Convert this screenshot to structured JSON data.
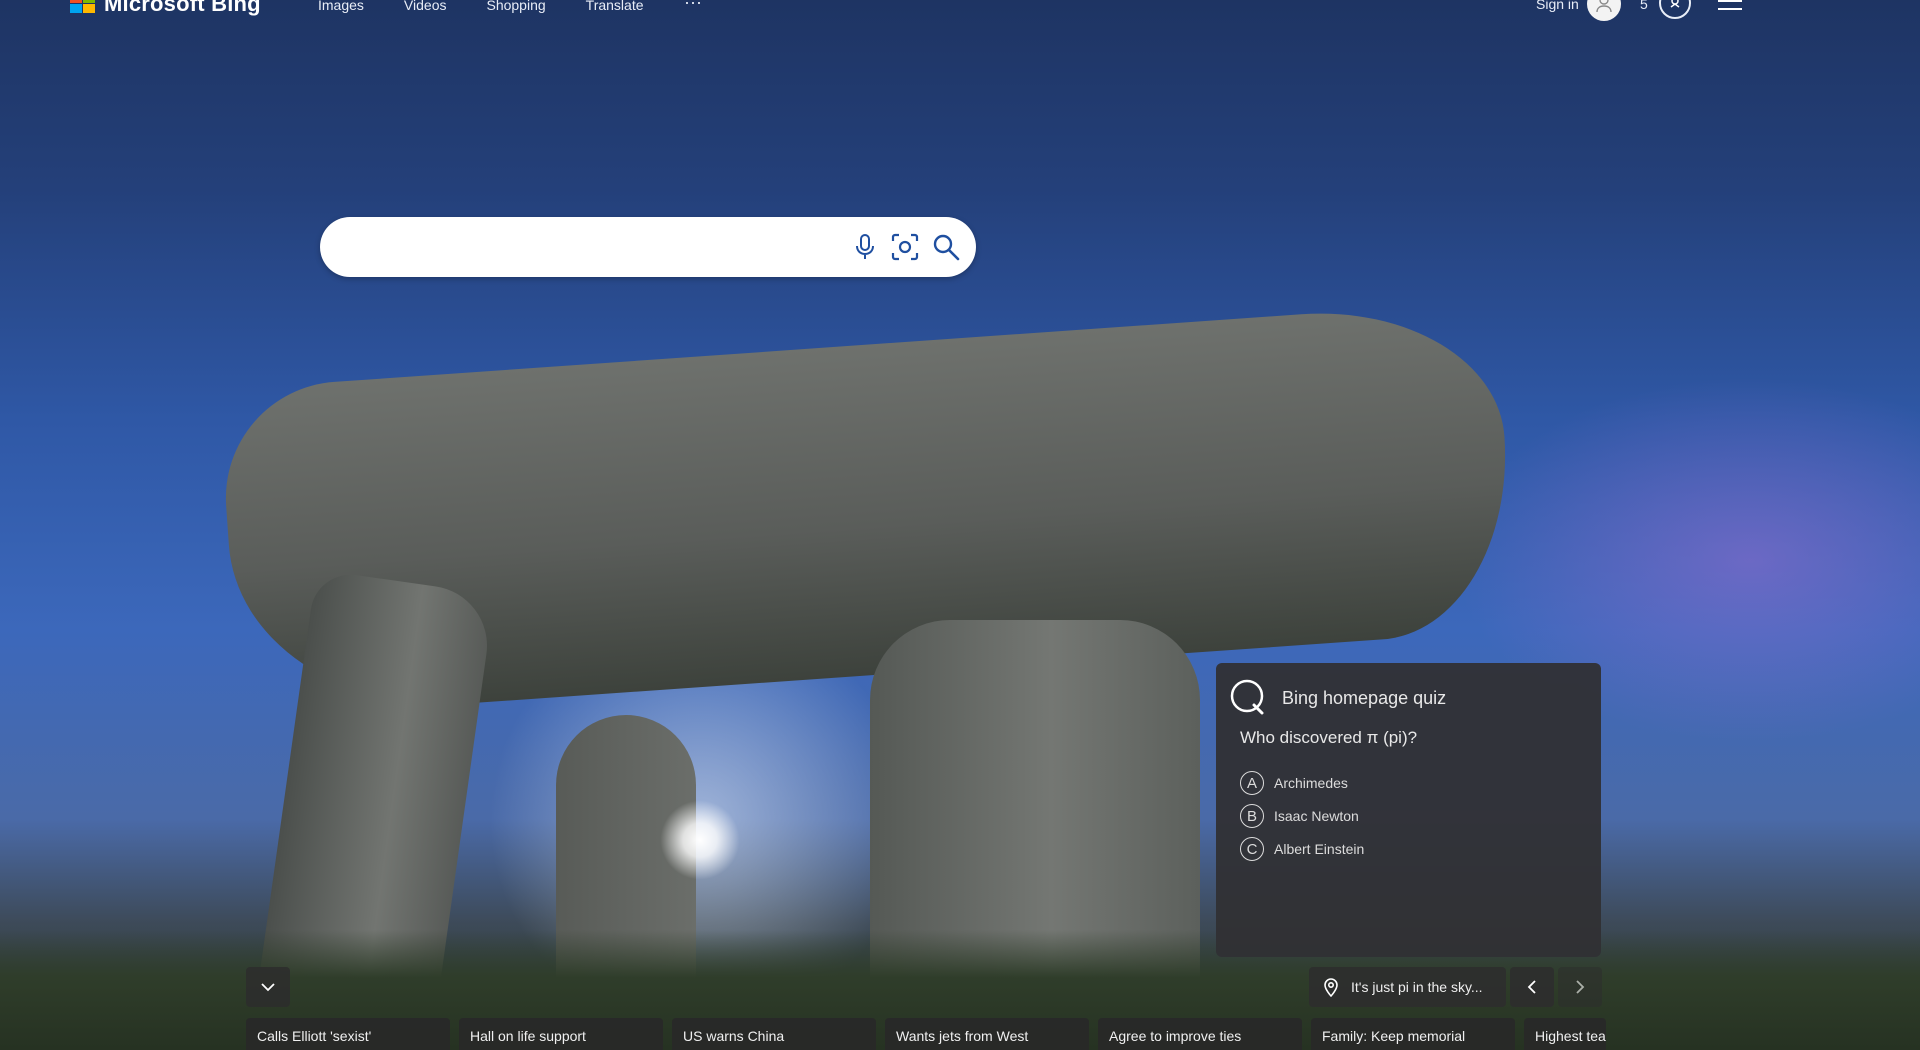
{
  "header": {
    "logo_text": "Microsoft Bing",
    "nav": [
      "Images",
      "Videos",
      "Shopping",
      "Translate"
    ],
    "more_label": "···",
    "sign_in": "Sign in",
    "rewards_count": "5",
    "colors": {
      "ms_red": "#f25022",
      "ms_green": "#7fba00",
      "ms_blue": "#00a4ef",
      "ms_yellow": "#ffb900"
    }
  },
  "search": {
    "placeholder": "",
    "value": ""
  },
  "quiz": {
    "title": "Bing homepage quiz",
    "question": "Who discovered π (pi)?",
    "options": [
      {
        "letter": "A",
        "text": "Archimedes"
      },
      {
        "letter": "B",
        "text": "Isaac Newton"
      },
      {
        "letter": "C",
        "text": "Albert Einstein"
      }
    ]
  },
  "image_info": {
    "caption": "It's just pi in the sky..."
  },
  "news": [
    "Calls Elliott 'sexist'",
    "Hall on life support",
    "US warns China",
    "Wants jets from West",
    "Agree to improve ties",
    "Family: Keep memorial",
    "Highest tea"
  ]
}
